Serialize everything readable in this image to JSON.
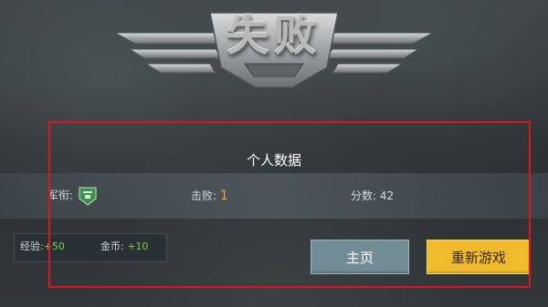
{
  "banner": {
    "title": "失败"
  },
  "panel": {
    "title": "个人数据"
  },
  "stats": {
    "rank_label": "军衔:",
    "kills_label": "击败:",
    "kills_value": "1",
    "score_label": "分数:",
    "score_value": "42"
  },
  "rewards": {
    "exp_label": "经验:",
    "exp_value": "+50",
    "gold_label": "金币:",
    "gold_value": "+10"
  },
  "buttons": {
    "home": "主页",
    "restart": "重新游戏"
  },
  "colors": {
    "accent_orange": "#f4a633",
    "reward_green": "#79d04a",
    "restart_button": "#efba2c",
    "home_button": "#728c95",
    "highlight": "#e0141b"
  },
  "icons": {
    "banner": "winged-emblem-icon",
    "rank": "rank-badge-icon"
  }
}
